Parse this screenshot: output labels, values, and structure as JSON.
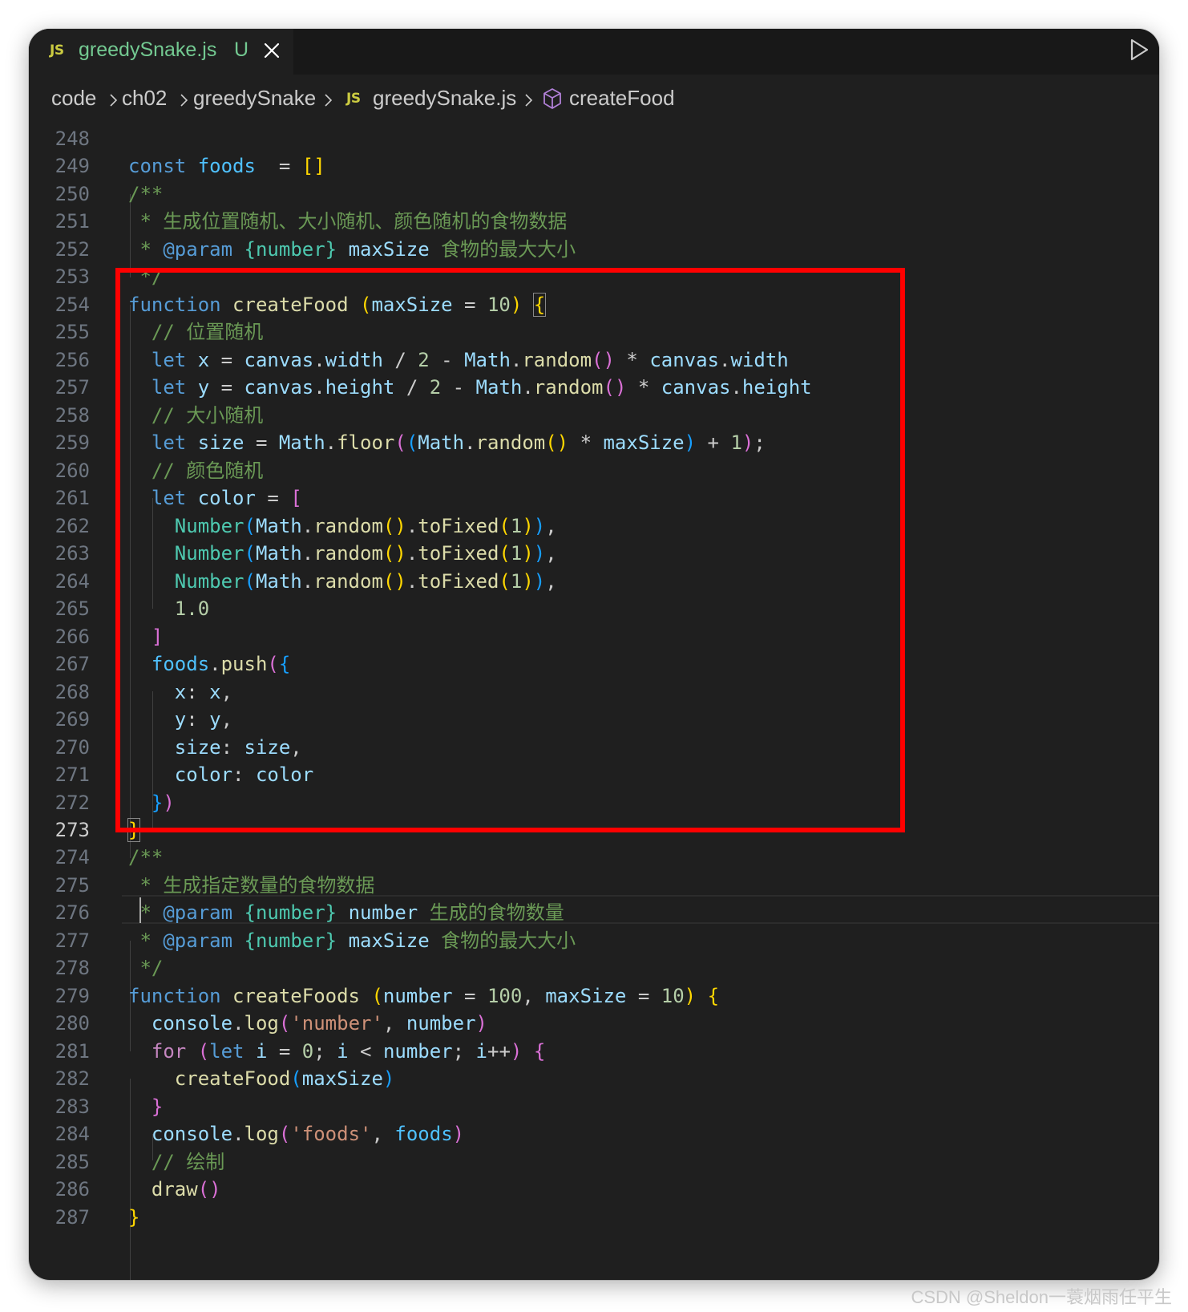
{
  "tab": {
    "icon": "JS",
    "filename": "greedySnake.js",
    "status": "U"
  },
  "breadcrumb": {
    "items": [
      "code",
      "ch02",
      "greedySnake"
    ],
    "file_icon": "JS",
    "file": "greedySnake.js",
    "symbol": "createFood"
  },
  "editor": {
    "active_line": "273",
    "lines": [
      {
        "n": "248",
        "t": []
      },
      {
        "n": "249",
        "t": [
          [
            "kw",
            "const "
          ],
          [
            "cst",
            "foods"
          ],
          [
            "",
            "  = "
          ],
          [
            "b1",
            "[]"
          ]
        ]
      },
      {
        "n": "250",
        "t": [
          [
            "cmt",
            "/**"
          ]
        ]
      },
      {
        "n": "251",
        "t": [
          [
            "cmt",
            " * 生成位置随机、大小随机、颜色随机的食物数据"
          ]
        ]
      },
      {
        "n": "252",
        "t": [
          [
            "cmt",
            " * "
          ],
          [
            "kw",
            "@param"
          ],
          [
            "cmt",
            " "
          ],
          [
            "typ",
            "{number}"
          ],
          [
            "cmt",
            " "
          ],
          [
            "var",
            "maxSize"
          ],
          [
            "cmt",
            " 食物的最大大小"
          ]
        ]
      },
      {
        "n": "253",
        "t": [
          [
            "cmt",
            " */"
          ]
        ]
      },
      {
        "n": "254",
        "t": [
          [
            "kw",
            "function "
          ],
          [
            "fn",
            "createFood"
          ],
          [
            "",
            " "
          ],
          [
            "b1",
            "("
          ],
          [
            "var",
            "maxSize"
          ],
          [
            "",
            " = "
          ],
          [
            "num",
            "10"
          ],
          [
            "b1",
            ")"
          ],
          [
            "",
            " "
          ],
          [
            "b1",
            "{"
          ]
        ]
      },
      {
        "n": "255",
        "t": [
          [
            "cmt",
            "  // 位置随机"
          ]
        ]
      },
      {
        "n": "256",
        "t": [
          [
            "",
            "  "
          ],
          [
            "kw",
            "let "
          ],
          [
            "var",
            "x"
          ],
          [
            "",
            " = "
          ],
          [
            "var",
            "canvas"
          ],
          [
            "",
            "."
          ],
          [
            "var",
            "width"
          ],
          [
            "",
            " / "
          ],
          [
            "num",
            "2"
          ],
          [
            "",
            " - "
          ],
          [
            "var",
            "Math"
          ],
          [
            "",
            "."
          ],
          [
            "fn",
            "random"
          ],
          [
            "b2",
            "()"
          ],
          [
            "",
            " * "
          ],
          [
            "var",
            "canvas"
          ],
          [
            "",
            "."
          ],
          [
            "var",
            "width"
          ]
        ]
      },
      {
        "n": "257",
        "t": [
          [
            "",
            "  "
          ],
          [
            "kw",
            "let "
          ],
          [
            "var",
            "y"
          ],
          [
            "",
            " = "
          ],
          [
            "var",
            "canvas"
          ],
          [
            "",
            "."
          ],
          [
            "var",
            "height"
          ],
          [
            "",
            " / "
          ],
          [
            "num",
            "2"
          ],
          [
            "",
            " - "
          ],
          [
            "var",
            "Math"
          ],
          [
            "",
            "."
          ],
          [
            "fn",
            "random"
          ],
          [
            "b2",
            "()"
          ],
          [
            "",
            " * "
          ],
          [
            "var",
            "canvas"
          ],
          [
            "",
            "."
          ],
          [
            "var",
            "height"
          ]
        ]
      },
      {
        "n": "258",
        "t": [
          [
            "cmt",
            "  // 大小随机"
          ]
        ]
      },
      {
        "n": "259",
        "t": [
          [
            "",
            "  "
          ],
          [
            "kw",
            "let "
          ],
          [
            "var",
            "size"
          ],
          [
            "",
            " = "
          ],
          [
            "var",
            "Math"
          ],
          [
            "",
            "."
          ],
          [
            "fn",
            "floor"
          ],
          [
            "b2",
            "("
          ],
          [
            "b3",
            "("
          ],
          [
            "var",
            "Math"
          ],
          [
            "",
            "."
          ],
          [
            "fn",
            "random"
          ],
          [
            "b1",
            "()"
          ],
          [
            "",
            " * "
          ],
          [
            "var",
            "maxSize"
          ],
          [
            "b3",
            ")"
          ],
          [
            "",
            " + "
          ],
          [
            "num",
            "1"
          ],
          [
            "b2",
            ")"
          ],
          [
            "",
            ";"
          ]
        ]
      },
      {
        "n": "260",
        "t": [
          [
            "cmt",
            "  // 颜色随机"
          ]
        ]
      },
      {
        "n": "261",
        "t": [
          [
            "",
            "  "
          ],
          [
            "kw",
            "let "
          ],
          [
            "var",
            "color"
          ],
          [
            "",
            " = "
          ],
          [
            "b2",
            "["
          ]
        ]
      },
      {
        "n": "262",
        "t": [
          [
            "",
            "    "
          ],
          [
            "typ",
            "Number"
          ],
          [
            "b3",
            "("
          ],
          [
            "var",
            "Math"
          ],
          [
            "",
            "."
          ],
          [
            "fn",
            "random"
          ],
          [
            "b1",
            "()"
          ],
          [
            "",
            "."
          ],
          [
            "fn",
            "toFixed"
          ],
          [
            "b1",
            "("
          ],
          [
            "num",
            "1"
          ],
          [
            "b1",
            ")"
          ],
          [
            "b3",
            ")"
          ],
          [
            "",
            ","
          ]
        ]
      },
      {
        "n": "263",
        "t": [
          [
            "",
            "    "
          ],
          [
            "typ",
            "Number"
          ],
          [
            "b3",
            "("
          ],
          [
            "var",
            "Math"
          ],
          [
            "",
            "."
          ],
          [
            "fn",
            "random"
          ],
          [
            "b1",
            "()"
          ],
          [
            "",
            "."
          ],
          [
            "fn",
            "toFixed"
          ],
          [
            "b1",
            "("
          ],
          [
            "num",
            "1"
          ],
          [
            "b1",
            ")"
          ],
          [
            "b3",
            ")"
          ],
          [
            "",
            ","
          ]
        ]
      },
      {
        "n": "264",
        "t": [
          [
            "",
            "    "
          ],
          [
            "typ",
            "Number"
          ],
          [
            "b3",
            "("
          ],
          [
            "var",
            "Math"
          ],
          [
            "",
            "."
          ],
          [
            "fn",
            "random"
          ],
          [
            "b1",
            "()"
          ],
          [
            "",
            "."
          ],
          [
            "fn",
            "toFixed"
          ],
          [
            "b1",
            "("
          ],
          [
            "num",
            "1"
          ],
          [
            "b1",
            ")"
          ],
          [
            "b3",
            ")"
          ],
          [
            "",
            ","
          ]
        ]
      },
      {
        "n": "265",
        "t": [
          [
            "",
            "    "
          ],
          [
            "num",
            "1.0"
          ]
        ]
      },
      {
        "n": "266",
        "t": [
          [
            "",
            "  "
          ],
          [
            "b2",
            "]"
          ]
        ]
      },
      {
        "n": "267",
        "t": [
          [
            "",
            "  "
          ],
          [
            "cst",
            "foods"
          ],
          [
            "",
            "."
          ],
          [
            "fn",
            "push"
          ],
          [
            "b2",
            "("
          ],
          [
            "b3",
            "{"
          ]
        ]
      },
      {
        "n": "268",
        "t": [
          [
            "",
            "    "
          ],
          [
            "var",
            "x"
          ],
          [
            "",
            ": "
          ],
          [
            "var",
            "x"
          ],
          [
            "",
            ","
          ]
        ]
      },
      {
        "n": "269",
        "t": [
          [
            "",
            "    "
          ],
          [
            "var",
            "y"
          ],
          [
            "",
            ": "
          ],
          [
            "var",
            "y"
          ],
          [
            "",
            ","
          ]
        ]
      },
      {
        "n": "270",
        "t": [
          [
            "",
            "    "
          ],
          [
            "var",
            "size"
          ],
          [
            "",
            ": "
          ],
          [
            "var",
            "size"
          ],
          [
            "",
            ","
          ]
        ]
      },
      {
        "n": "271",
        "t": [
          [
            "",
            "    "
          ],
          [
            "var",
            "color"
          ],
          [
            "",
            ": "
          ],
          [
            "var",
            "color"
          ]
        ]
      },
      {
        "n": "272",
        "t": [
          [
            "",
            "  "
          ],
          [
            "b3",
            "}"
          ],
          [
            "b2",
            ")"
          ]
        ]
      },
      {
        "n": "273",
        "t": [
          [
            "b1",
            "}"
          ]
        ]
      },
      {
        "n": "274",
        "t": [
          [
            "cmt",
            "/**"
          ]
        ]
      },
      {
        "n": "275",
        "t": [
          [
            "cmt",
            " * 生成指定数量的食物数据"
          ]
        ]
      },
      {
        "n": "276",
        "t": [
          [
            "cmt",
            " * "
          ],
          [
            "kw",
            "@param"
          ],
          [
            "cmt",
            " "
          ],
          [
            "typ",
            "{number}"
          ],
          [
            "cmt",
            " "
          ],
          [
            "var",
            "number"
          ],
          [
            "cmt",
            " 生成的食物数量"
          ]
        ]
      },
      {
        "n": "277",
        "t": [
          [
            "cmt",
            " * "
          ],
          [
            "kw",
            "@param"
          ],
          [
            "cmt",
            " "
          ],
          [
            "typ",
            "{number}"
          ],
          [
            "cmt",
            " "
          ],
          [
            "var",
            "maxSize"
          ],
          [
            "cmt",
            " 食物的最大大小"
          ]
        ]
      },
      {
        "n": "278",
        "t": [
          [
            "cmt",
            " */"
          ]
        ]
      },
      {
        "n": "279",
        "t": [
          [
            "kw",
            "function "
          ],
          [
            "fn",
            "createFoods"
          ],
          [
            "",
            " "
          ],
          [
            "b1",
            "("
          ],
          [
            "var",
            "number"
          ],
          [
            "",
            " = "
          ],
          [
            "num",
            "100"
          ],
          [
            "",
            ", "
          ],
          [
            "var",
            "maxSize"
          ],
          [
            "",
            " = "
          ],
          [
            "num",
            "10"
          ],
          [
            "b1",
            ")"
          ],
          [
            "",
            " "
          ],
          [
            "b1",
            "{"
          ]
        ]
      },
      {
        "n": "280",
        "t": [
          [
            "",
            "  "
          ],
          [
            "var",
            "console"
          ],
          [
            "",
            "."
          ],
          [
            "fn",
            "log"
          ],
          [
            "b2",
            "("
          ],
          [
            "str",
            "'number'"
          ],
          [
            "",
            ", "
          ],
          [
            "var",
            "number"
          ],
          [
            "b2",
            ")"
          ]
        ]
      },
      {
        "n": "281",
        "t": [
          [
            "",
            "  "
          ],
          [
            "ctl",
            "for "
          ],
          [
            "b2",
            "("
          ],
          [
            "kw",
            "let "
          ],
          [
            "var",
            "i"
          ],
          [
            "",
            " = "
          ],
          [
            "num",
            "0"
          ],
          [
            "",
            "; "
          ],
          [
            "var",
            "i"
          ],
          [
            "",
            " < "
          ],
          [
            "var",
            "number"
          ],
          [
            "",
            "; "
          ],
          [
            "var",
            "i"
          ],
          [
            "",
            "++"
          ],
          [
            "b2",
            ")"
          ],
          [
            "",
            " "
          ],
          [
            "b2",
            "{"
          ]
        ]
      },
      {
        "n": "282",
        "t": [
          [
            "",
            "    "
          ],
          [
            "fn",
            "createFood"
          ],
          [
            "b3",
            "("
          ],
          [
            "var",
            "maxSize"
          ],
          [
            "b3",
            ")"
          ]
        ]
      },
      {
        "n": "283",
        "t": [
          [
            "",
            "  "
          ],
          [
            "b2",
            "}"
          ]
        ]
      },
      {
        "n": "284",
        "t": [
          [
            "",
            "  "
          ],
          [
            "var",
            "console"
          ],
          [
            "",
            "."
          ],
          [
            "fn",
            "log"
          ],
          [
            "b2",
            "("
          ],
          [
            "str",
            "'foods'"
          ],
          [
            "",
            ", "
          ],
          [
            "cst",
            "foods"
          ],
          [
            "b2",
            ")"
          ]
        ]
      },
      {
        "n": "285",
        "t": [
          [
            "cmt",
            "  // 绘制"
          ]
        ]
      },
      {
        "n": "286",
        "t": [
          [
            "",
            "  "
          ],
          [
            "fn",
            "draw"
          ],
          [
            "b2",
            "()"
          ]
        ]
      },
      {
        "n": "287",
        "t": [
          [
            "b1",
            "}"
          ]
        ]
      }
    ]
  },
  "watermark": "CSDN @Sheldon一蓑烟雨任平生"
}
